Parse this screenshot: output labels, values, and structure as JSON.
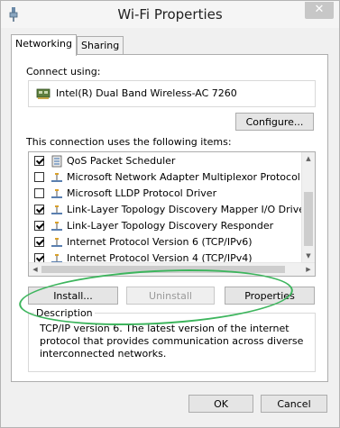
{
  "window": {
    "title": "Wi-Fi Properties",
    "close_symbol": "✕"
  },
  "tabs": [
    {
      "label": "Networking",
      "active": true
    },
    {
      "label": "Sharing",
      "active": false
    }
  ],
  "networking": {
    "connect_using_label": "Connect using:",
    "adapter_name": "Intel(R) Dual Band Wireless-AC 7260",
    "configure_button": "Configure...",
    "items_label": "This connection uses the following items:",
    "items": [
      {
        "label": "QoS Packet Scheduler",
        "checked": true,
        "icon": "scheduler-icon"
      },
      {
        "label": "Microsoft Network Adapter Multiplexor Protocol",
        "checked": false,
        "icon": "protocol-icon"
      },
      {
        "label": "Microsoft LLDP Protocol Driver",
        "checked": false,
        "icon": "protocol-icon"
      },
      {
        "label": "Link-Layer Topology Discovery Mapper I/O Driver",
        "checked": true,
        "icon": "protocol-icon"
      },
      {
        "label": "Link-Layer Topology Discovery Responder",
        "checked": true,
        "icon": "protocol-icon"
      },
      {
        "label": "Internet Protocol Version 6 (TCP/IPv6)",
        "checked": true,
        "icon": "protocol-icon"
      },
      {
        "label": "Internet Protocol Version 4 (TCP/IPv4)",
        "checked": true,
        "icon": "protocol-icon"
      }
    ],
    "install_button": "Install...",
    "uninstall_button": "Uninstall",
    "properties_button": "Properties",
    "description_title": "Description",
    "description_text": "TCP/IP version 6. The latest version of the internet protocol that provides communication across diverse interconnected networks."
  },
  "footer": {
    "ok_button": "OK",
    "cancel_button": "Cancel"
  },
  "colors": {
    "highlight_ellipse": "#3db55d"
  }
}
